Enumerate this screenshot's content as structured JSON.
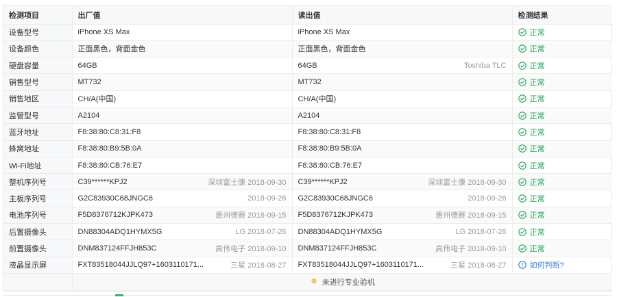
{
  "headers": [
    "检测项目",
    "出厂值",
    "读出值",
    "检测结果"
  ],
  "rows": [
    {
      "label": "设备型号",
      "factory": "iPhone XS Max",
      "factory_note": "",
      "read": "iPhone XS Max",
      "read_note": "",
      "result": "正常",
      "result_type": "ok"
    },
    {
      "label": "设备颜色",
      "factory": "正面黑色，背面金色",
      "factory_note": "",
      "read": "正面黑色，背面金色",
      "read_note": "",
      "result": "正常",
      "result_type": "ok"
    },
    {
      "label": "硬盘容量",
      "factory": "64GB",
      "factory_note": "",
      "read": "64GB",
      "read_note": "Toshiba TLC",
      "result": "正常",
      "result_type": "ok"
    },
    {
      "label": "销售型号",
      "factory": "MT732",
      "factory_note": "",
      "read": "MT732",
      "read_note": "",
      "result": "正常",
      "result_type": "ok"
    },
    {
      "label": "销售地区",
      "factory": "CH/A(中国)",
      "factory_note": "",
      "read": "CH/A(中国)",
      "read_note": "",
      "result": "正常",
      "result_type": "ok"
    },
    {
      "label": "监管型号",
      "factory": "A2104",
      "factory_note": "",
      "read": "A2104",
      "read_note": "",
      "result": "正常",
      "result_type": "ok"
    },
    {
      "label": "蓝牙地址",
      "factory": "F8:38:80:C8:31:F8",
      "factory_note": "",
      "read": "F8:38:80:C8:31:F8",
      "read_note": "",
      "result": "正常",
      "result_type": "ok"
    },
    {
      "label": "蜂窝地址",
      "factory": "F8:38:80:B9:5B:0A",
      "factory_note": "",
      "read": "F8:38:80:B9:5B:0A",
      "read_note": "",
      "result": "正常",
      "result_type": "ok"
    },
    {
      "label": "Wi-Fi地址",
      "factory": "F8:38:80:CB:76:E7",
      "factory_note": "",
      "read": "F8:38:80:CB:76:E7",
      "read_note": "",
      "result": "正常",
      "result_type": "ok"
    },
    {
      "label": "整机序列号",
      "factory": "C39******KPJ2",
      "factory_note": "深圳富士康 2018-09-30",
      "read": "C39******KPJ2",
      "read_note": "深圳富士康 2018-09-30",
      "result": "正常",
      "result_type": "ok"
    },
    {
      "label": "主板序列号",
      "factory": "G2C83930C68JNGC6",
      "factory_note": "2018-09-26",
      "read": "G2C83930C68JNGC6",
      "read_note": "2018-09-26",
      "result": "正常",
      "result_type": "ok"
    },
    {
      "label": "电池序列号",
      "factory": "F5D8376712KJPK473",
      "factory_note": "惠州德赛 2018-09-15",
      "read": "F5D8376712KJPK473",
      "read_note": "惠州德赛 2018-09-15",
      "result": "正常",
      "result_type": "ok"
    },
    {
      "label": "后置摄像头",
      "factory": "DN88304ADQ1HYMX5G",
      "factory_note": "LG 2018-07-26",
      "read": "DN88304ADQ1HYMX5G",
      "read_note": "LG 2018-07-26",
      "result": "正常",
      "result_type": "ok"
    },
    {
      "label": "前置摄像头",
      "factory": "DNM837124FFJH853C",
      "factory_note": "高伟电子 2018-09-10",
      "read": "DNM837124FFJH853C",
      "read_note": "高伟电子 2018-09-10",
      "result": "正常",
      "result_type": "ok"
    },
    {
      "label": "液晶显示屏",
      "factory": "FXT83518044JJLQ97+1603110171...",
      "factory_note": "三星 2018-08-27",
      "read": "FXT83518044JJLQ97+1603110171...",
      "read_note": "三星 2018-08-27",
      "result": "如何判断?",
      "result_type": "question"
    }
  ],
  "footer": {
    "text": "未进行专业验机",
    "icon": "diamond-icon"
  },
  "colors": {
    "ok": "#21a65b",
    "link": "#2f7fe0",
    "note": "#9a9a9a",
    "header_bg": "#f7f8fa",
    "footer_icon": "#f5a623"
  }
}
